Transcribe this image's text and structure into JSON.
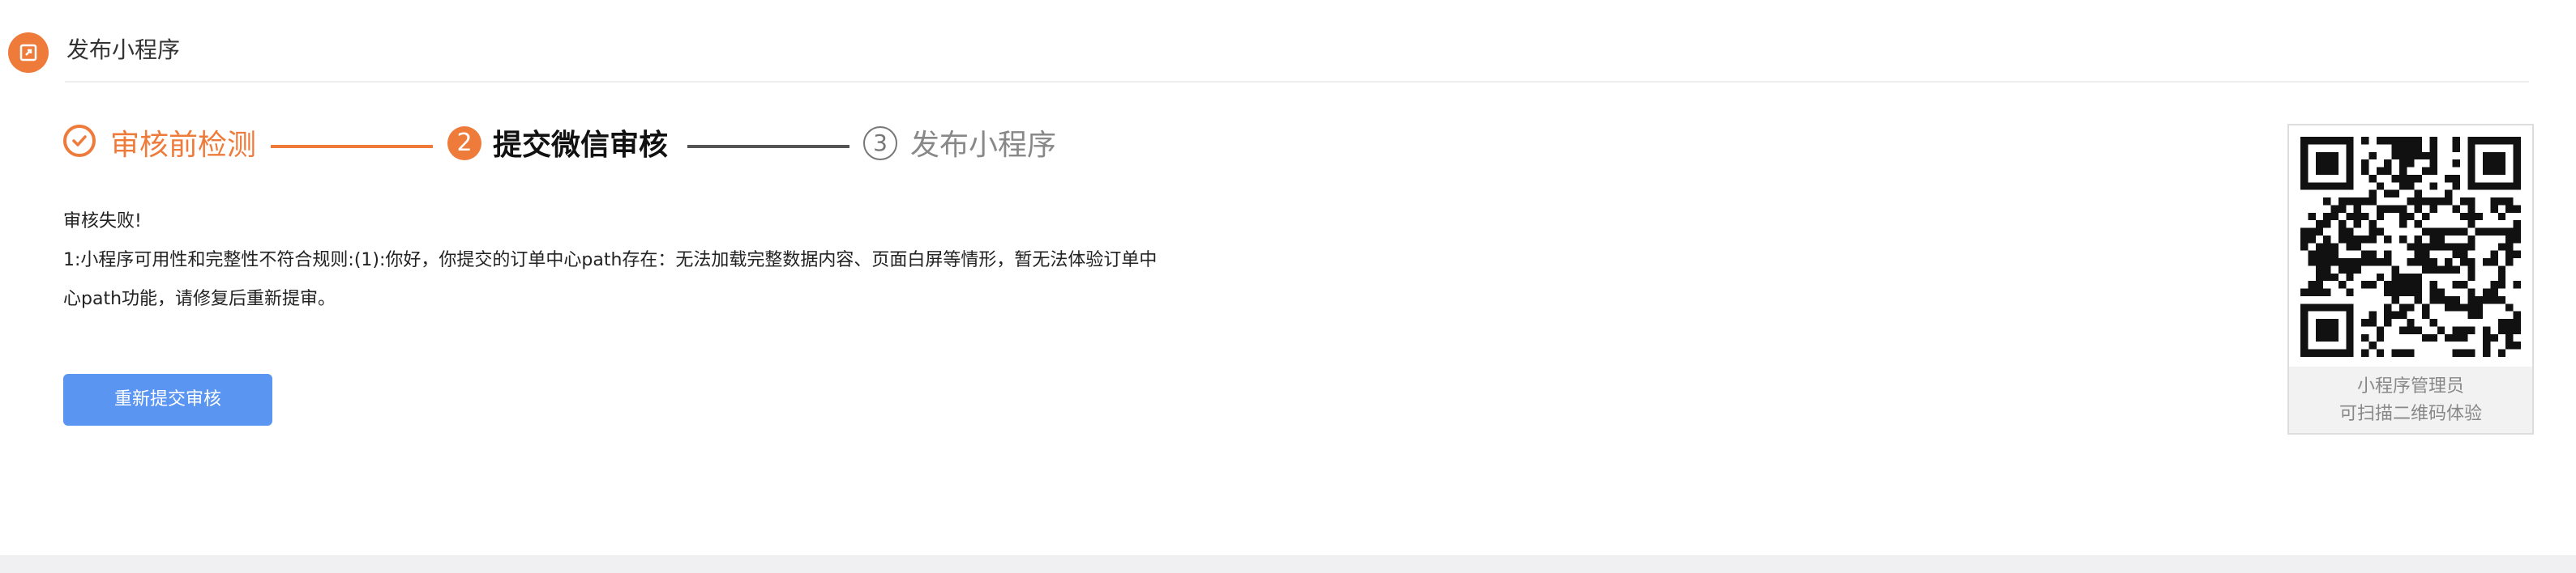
{
  "header": {
    "title": "发布小程序",
    "icon": "publish-icon"
  },
  "steps": [
    {
      "index": "",
      "label": "审核前检测",
      "state": "done"
    },
    {
      "index": "2",
      "label": "提交微信审核",
      "state": "active"
    },
    {
      "index": "3",
      "label": "发布小程序",
      "state": "pending"
    }
  ],
  "result": {
    "title": "审核失败!",
    "line1": "1:小程序可用性和完整性不符合规则:(1):你好，你提交的订单中心path存在：无法加载完整数据内容、页面白屏等情形，暂无法体验订单中",
    "line2": "心path功能，请修复后重新提审。"
  },
  "actions": {
    "resubmit_label": "重新提交审核"
  },
  "qr": {
    "caption_line1": "小程序管理员",
    "caption_line2": "可扫描二维码体验"
  },
  "colors": {
    "accent": "#ef7b3b",
    "button": "#5b95f2"
  }
}
